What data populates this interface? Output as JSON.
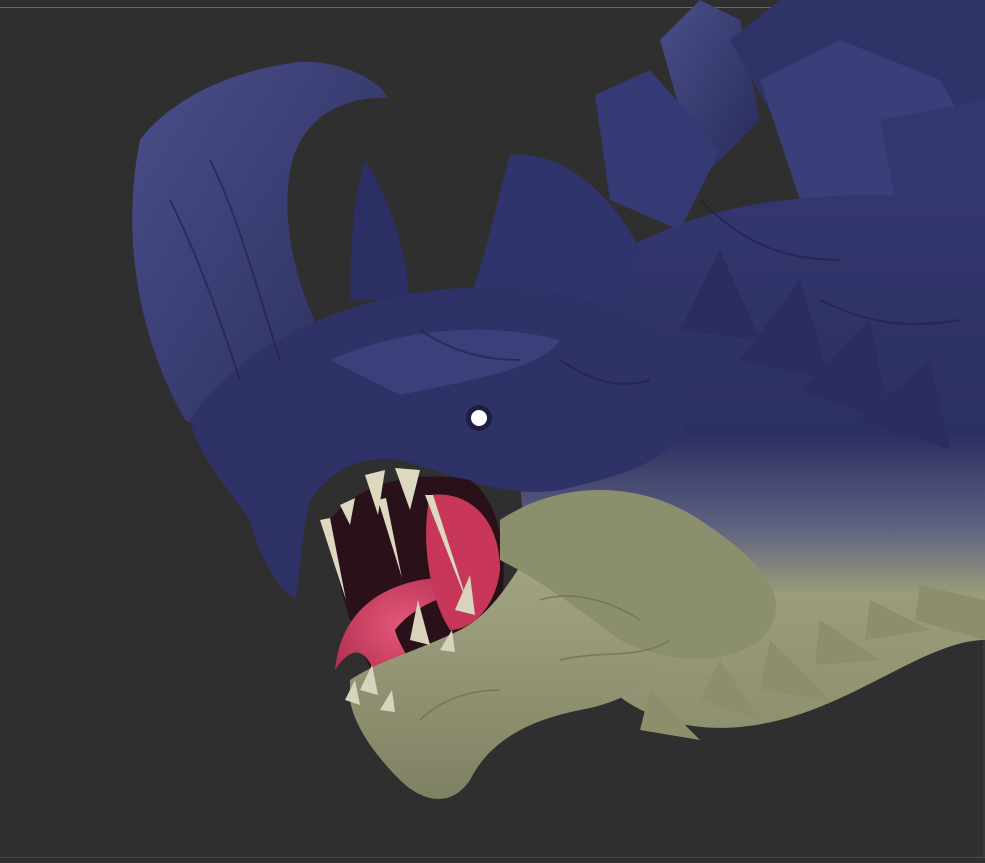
{
  "viewport": {
    "background": "#2f2f2f",
    "object": "dragon-head-sculpt"
  },
  "colors": {
    "upper_scales": "#2e3166",
    "upper_highlight": "#5a5f9a",
    "lower_skin": "#9ea07a",
    "lower_shadow": "#5f6148",
    "tongue": "#d23c5c",
    "mouth_inside": "#2a1018",
    "teeth": "#ddd8c0",
    "eye": "#ffffff"
  }
}
